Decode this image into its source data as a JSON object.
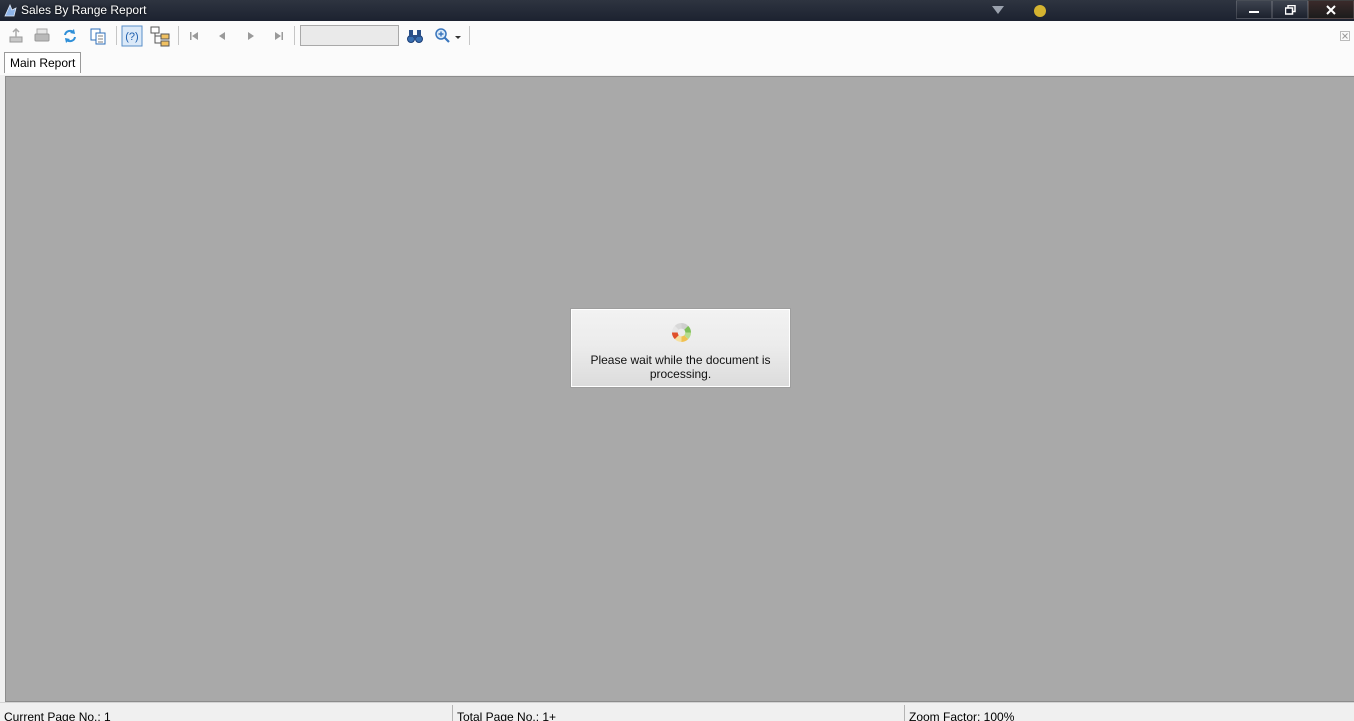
{
  "window": {
    "title": "Sales By Range Report",
    "buttons": [
      "minimize",
      "restore",
      "close"
    ]
  },
  "toolbar": {
    "icons": [
      "export-icon",
      "print-icon",
      "refresh-icon",
      "copy-icon",
      "help-icon",
      "group-tree-icon",
      "first-page-icon",
      "prev-page-icon",
      "next-page-icon",
      "last-page-icon",
      "find-icon",
      "zoom-icon"
    ],
    "page_field_value": ""
  },
  "tabs": [
    {
      "label": "Main Report"
    }
  ],
  "dialog": {
    "message": "Please wait while the document is processing."
  },
  "status": {
    "current_page": "Current Page No.: 1",
    "total_page": "Total Page No.: 1+",
    "zoom": "Zoom Factor: 100%"
  },
  "colors": {
    "viewer_bg": "#a9a9a9",
    "titlebar": "#1c2230",
    "accent_blue": "#2f7fc7"
  }
}
